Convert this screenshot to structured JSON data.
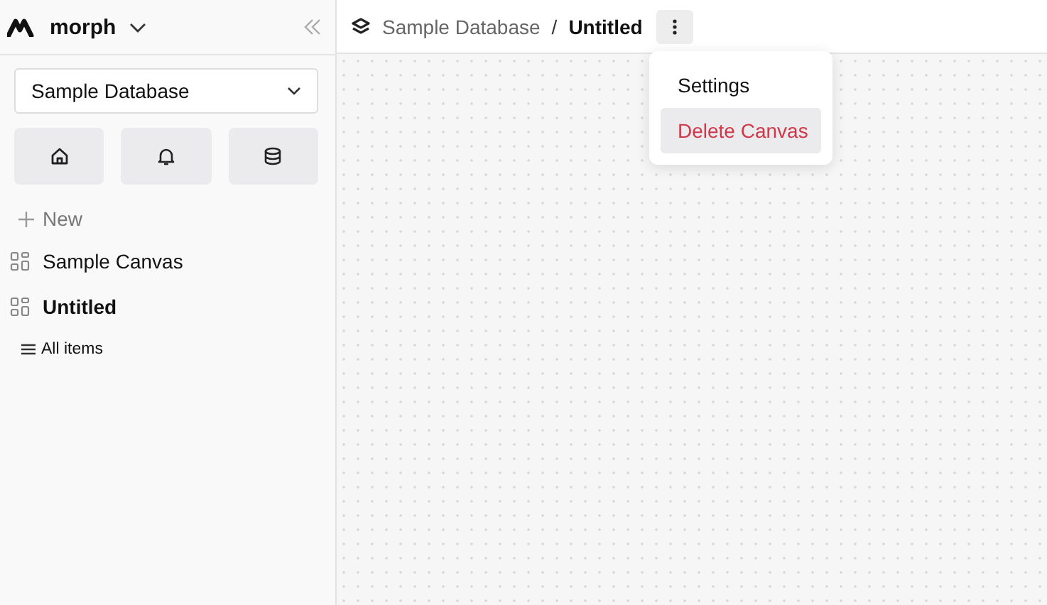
{
  "workspace": {
    "name": "morph"
  },
  "database_select": {
    "value": "Sample Database"
  },
  "new_button": {
    "label": "New"
  },
  "canvases": [
    {
      "label": "Sample Canvas",
      "selected": false
    },
    {
      "label": "Untitled",
      "selected": true
    }
  ],
  "all_items": {
    "label": "All items"
  },
  "breadcrumb": {
    "database": "Sample Database",
    "separator": "/",
    "current": "Untitled"
  },
  "menu": [
    {
      "label": "Settings",
      "kind": "normal",
      "selected": false
    },
    {
      "label": "Delete Canvas",
      "kind": "danger",
      "selected": true
    }
  ]
}
